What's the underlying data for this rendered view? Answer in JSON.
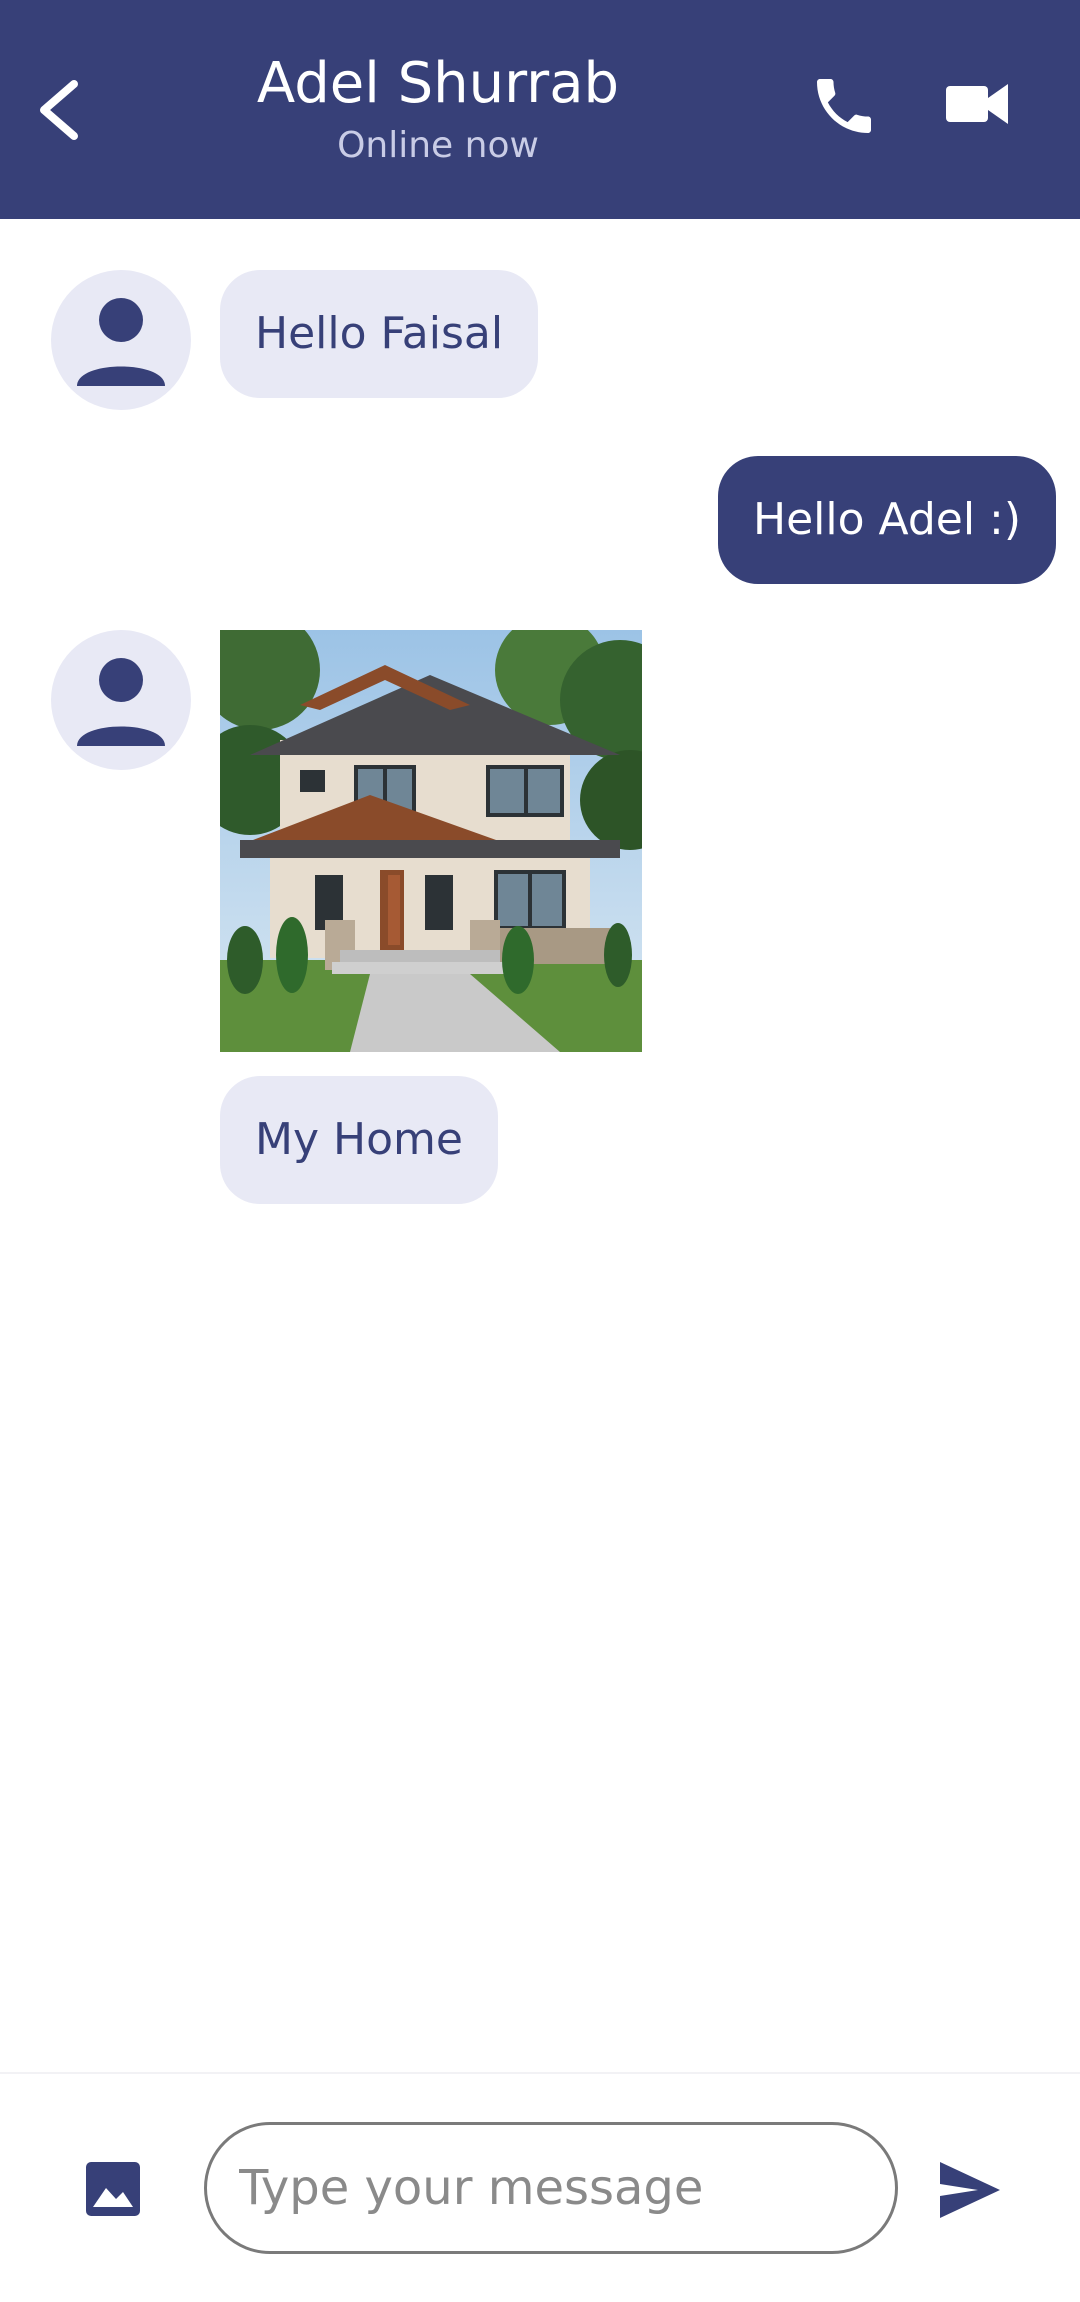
{
  "header": {
    "back_icon": "chevron-left-icon",
    "title": "Adel Shurrab",
    "status": "Online now",
    "call_icon": "phone-icon",
    "video_icon": "video-camera-icon"
  },
  "messages": [
    {
      "direction": "incoming",
      "type": "text",
      "text": "Hello Faisal"
    },
    {
      "direction": "outgoing",
      "type": "text",
      "text": "Hello Adel :)"
    },
    {
      "direction": "incoming",
      "type": "image",
      "image": "two-story house photo"
    },
    {
      "direction": "incoming",
      "type": "text",
      "text": "My Home"
    }
  ],
  "composer": {
    "gallery_icon": "image-icon",
    "placeholder": "Type your message",
    "value": "",
    "send_icon": "send-icon"
  },
  "colors": {
    "primary": "#374078",
    "incoming_bubble": "#e8e9f5",
    "subtitle": "#c9cce6"
  }
}
